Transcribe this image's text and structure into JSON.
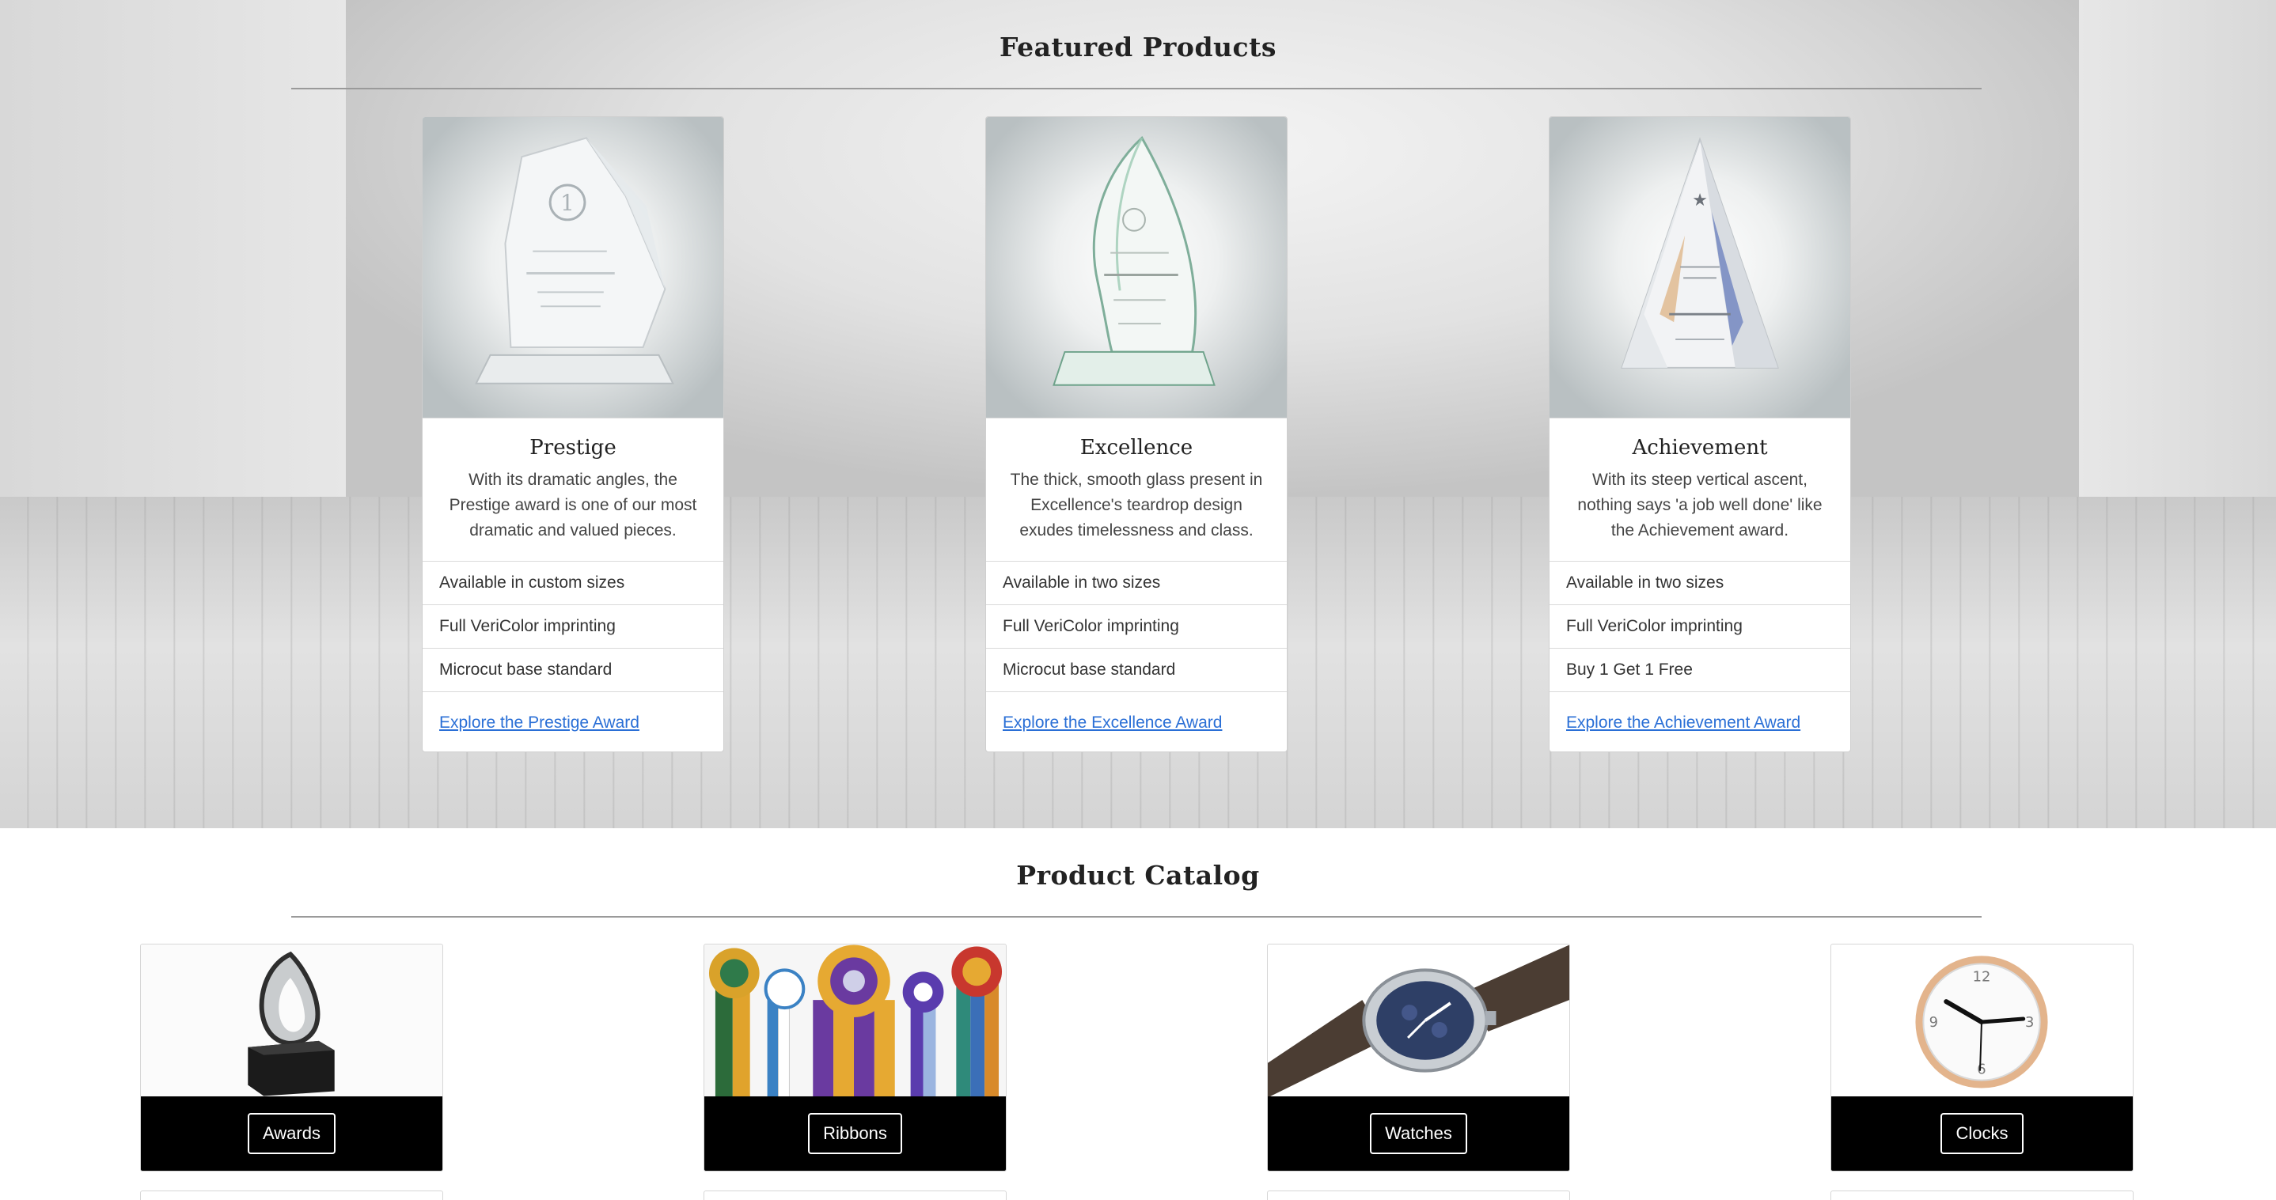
{
  "featured": {
    "title": "Featured Products",
    "cards": [
      {
        "title": "Prestige",
        "description": "With its dramatic angles, the Prestige award is one of our most dramatic and valued pieces.",
        "features": [
          "Available in custom sizes",
          "Full VeriColor imprinting",
          "Microcut base standard"
        ],
        "link": "Explore the Prestige Award"
      },
      {
        "title": "Excellence",
        "description": "The thick, smooth glass present in Excellence's teardrop design exudes timelessness and class.",
        "features": [
          "Available in two sizes",
          "Full VeriColor imprinting",
          "Microcut base standard"
        ],
        "link": "Explore the Excellence Award"
      },
      {
        "title": "Achievement",
        "description": "With its steep vertical ascent, nothing says 'a job well done' like the Achievement award.",
        "features": [
          "Available in two sizes",
          "Full VeriColor imprinting",
          "Buy 1 Get 1 Free"
        ],
        "link": "Explore the Achievement Award"
      }
    ]
  },
  "catalog": {
    "title": "Product Catalog",
    "items": [
      {
        "label": "Awards"
      },
      {
        "label": "Ribbons"
      },
      {
        "label": "Watches"
      },
      {
        "label": "Clocks"
      }
    ]
  },
  "colors": {
    "link": "#2a6fd6",
    "catalog_bar": "#000000"
  }
}
